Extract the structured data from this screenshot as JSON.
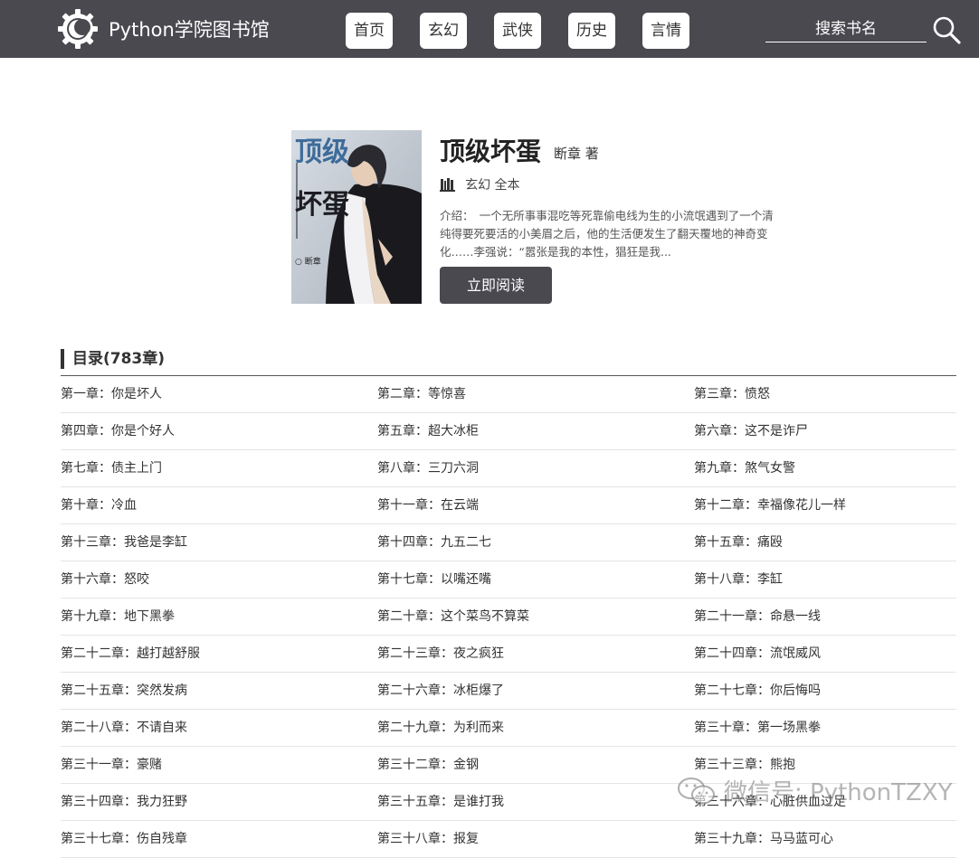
{
  "header": {
    "brand": "Python学院图书馆",
    "nav": [
      "首页",
      "玄幻",
      "武侠",
      "历史",
      "言情"
    ],
    "search_placeholder": "搜索书名",
    "colors": {
      "bar": "#4a4950",
      "text": "#ffffff"
    }
  },
  "book": {
    "title": "顶级坏蛋",
    "author": "断章 著",
    "meta": "玄幻 全本",
    "intro": "介绍：　一个无所事事混吃等死靠偷电线为生的小流氓遇到了一个清纯得要死要活的小美眉之后，他的生活便发生了翻天覆地的神奇变化……李强说：“嚣张是我的本性，猖狂是我...",
    "read_button": "立即阅读",
    "cover": {
      "title_line1": "顶级",
      "title_line2": "坏蛋",
      "author_mark": "○ 断章"
    }
  },
  "catalog": {
    "heading": "目录(783章)",
    "chapters": [
      "第一章：你是坏人",
      "第二章：等惊喜",
      "第三章：愤怒",
      "第四章：你是个好人",
      "第五章：超大冰柜",
      "第六章：这不是诈尸",
      "第七章：债主上门",
      "第八章：三刀六洞",
      "第九章：煞气女警",
      "第十章：冷血",
      "第十一章：在云端",
      "第十二章：幸福像花儿一样",
      "第十三章：我爸是李缸",
      "第十四章：九五二七",
      "第十五章：痛殴",
      "第十六章：怒咬",
      "第十七章：以嘴还嘴",
      "第十八章：李缸",
      "第十九章：地下黑拳",
      "第二十章：这个菜鸟不算菜",
      "第二十一章：命悬一线",
      "第二十二章：越打越舒服",
      "第二十三章：夜之疯狂",
      "第二十四章：流氓威风",
      "第二十五章：突然发病",
      "第二十六章：冰柜爆了",
      "第二十七章：你后悔吗",
      "第二十八章：不请自来",
      "第二十九章：为利而来",
      "第三十章：第一场黑拳",
      "第三十一章：豪赌",
      "第三十二章：金钢",
      "第三十三章：熊抱",
      "第三十四章：我力狂野",
      "第三十五章：是谁打我",
      "第三十六章：心脏供血过足",
      "第三十七章：伤自残章",
      "第三十八章：报复",
      "第三十九章：马马蓝可心"
    ]
  },
  "watermark": {
    "text": "微信号: PythonTZXY"
  }
}
